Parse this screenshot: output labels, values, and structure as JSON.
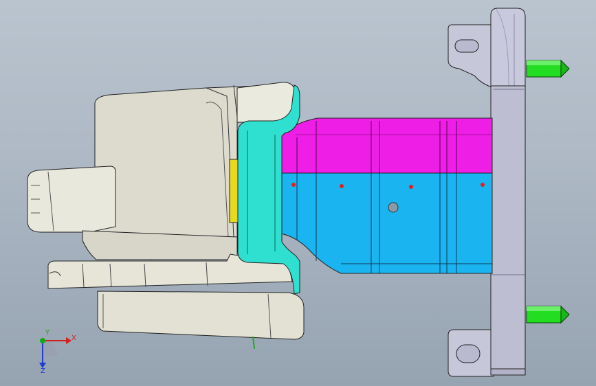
{
  "viewport": {
    "background_top": "#b9c4cf",
    "background_bottom": "#96a3b1"
  },
  "model": {
    "parts": [
      "mold-base-body",
      "insert-block",
      "cavity-core-cyan",
      "product-shell-magenta",
      "product-shell-blue",
      "clamp-plate",
      "guide-pin-top",
      "guide-pin-bottom"
    ],
    "colors": {
      "mold_base": "#dddccf",
      "cavity": "#2fe0d0",
      "product_top": "#ee1ee6",
      "product_bottom": "#1ab4f0",
      "plate": "#c8c8dc",
      "pins": "#22dd22",
      "insert": "#e8d820"
    }
  },
  "triad": {
    "x_label": "X",
    "y_label": "Y",
    "z_label": "Z",
    "x_color": "#d41e1e",
    "y_color": "#15a815",
    "z_color": "#1e3cd0"
  }
}
